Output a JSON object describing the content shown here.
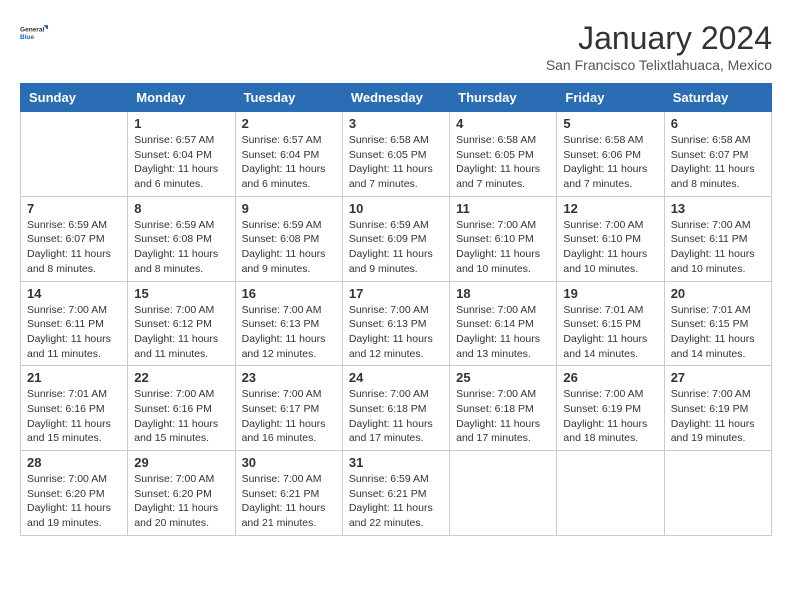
{
  "logo": {
    "line1": "General",
    "line2": "Blue"
  },
  "title": "January 2024",
  "location": "San Francisco Telixtlahuaca, Mexico",
  "headers": [
    "Sunday",
    "Monday",
    "Tuesday",
    "Wednesday",
    "Thursday",
    "Friday",
    "Saturday"
  ],
  "weeks": [
    [
      {
        "date": "",
        "info": ""
      },
      {
        "date": "1",
        "info": "Sunrise: 6:57 AM\nSunset: 6:04 PM\nDaylight: 11 hours\nand 6 minutes."
      },
      {
        "date": "2",
        "info": "Sunrise: 6:57 AM\nSunset: 6:04 PM\nDaylight: 11 hours\nand 6 minutes."
      },
      {
        "date": "3",
        "info": "Sunrise: 6:58 AM\nSunset: 6:05 PM\nDaylight: 11 hours\nand 7 minutes."
      },
      {
        "date": "4",
        "info": "Sunrise: 6:58 AM\nSunset: 6:05 PM\nDaylight: 11 hours\nand 7 minutes."
      },
      {
        "date": "5",
        "info": "Sunrise: 6:58 AM\nSunset: 6:06 PM\nDaylight: 11 hours\nand 7 minutes."
      },
      {
        "date": "6",
        "info": "Sunrise: 6:58 AM\nSunset: 6:07 PM\nDaylight: 11 hours\nand 8 minutes."
      }
    ],
    [
      {
        "date": "7",
        "info": "Sunrise: 6:59 AM\nSunset: 6:07 PM\nDaylight: 11 hours\nand 8 minutes."
      },
      {
        "date": "8",
        "info": "Sunrise: 6:59 AM\nSunset: 6:08 PM\nDaylight: 11 hours\nand 8 minutes."
      },
      {
        "date": "9",
        "info": "Sunrise: 6:59 AM\nSunset: 6:08 PM\nDaylight: 11 hours\nand 9 minutes."
      },
      {
        "date": "10",
        "info": "Sunrise: 6:59 AM\nSunset: 6:09 PM\nDaylight: 11 hours\nand 9 minutes."
      },
      {
        "date": "11",
        "info": "Sunrise: 7:00 AM\nSunset: 6:10 PM\nDaylight: 11 hours\nand 10 minutes."
      },
      {
        "date": "12",
        "info": "Sunrise: 7:00 AM\nSunset: 6:10 PM\nDaylight: 11 hours\nand 10 minutes."
      },
      {
        "date": "13",
        "info": "Sunrise: 7:00 AM\nSunset: 6:11 PM\nDaylight: 11 hours\nand 10 minutes."
      }
    ],
    [
      {
        "date": "14",
        "info": "Sunrise: 7:00 AM\nSunset: 6:11 PM\nDaylight: 11 hours\nand 11 minutes."
      },
      {
        "date": "15",
        "info": "Sunrise: 7:00 AM\nSunset: 6:12 PM\nDaylight: 11 hours\nand 11 minutes."
      },
      {
        "date": "16",
        "info": "Sunrise: 7:00 AM\nSunset: 6:13 PM\nDaylight: 11 hours\nand 12 minutes."
      },
      {
        "date": "17",
        "info": "Sunrise: 7:00 AM\nSunset: 6:13 PM\nDaylight: 11 hours\nand 12 minutes."
      },
      {
        "date": "18",
        "info": "Sunrise: 7:00 AM\nSunset: 6:14 PM\nDaylight: 11 hours\nand 13 minutes."
      },
      {
        "date": "19",
        "info": "Sunrise: 7:01 AM\nSunset: 6:15 PM\nDaylight: 11 hours\nand 14 minutes."
      },
      {
        "date": "20",
        "info": "Sunrise: 7:01 AM\nSunset: 6:15 PM\nDaylight: 11 hours\nand 14 minutes."
      }
    ],
    [
      {
        "date": "21",
        "info": "Sunrise: 7:01 AM\nSunset: 6:16 PM\nDaylight: 11 hours\nand 15 minutes."
      },
      {
        "date": "22",
        "info": "Sunrise: 7:00 AM\nSunset: 6:16 PM\nDaylight: 11 hours\nand 15 minutes."
      },
      {
        "date": "23",
        "info": "Sunrise: 7:00 AM\nSunset: 6:17 PM\nDaylight: 11 hours\nand 16 minutes."
      },
      {
        "date": "24",
        "info": "Sunrise: 7:00 AM\nSunset: 6:18 PM\nDaylight: 11 hours\nand 17 minutes."
      },
      {
        "date": "25",
        "info": "Sunrise: 7:00 AM\nSunset: 6:18 PM\nDaylight: 11 hours\nand 17 minutes."
      },
      {
        "date": "26",
        "info": "Sunrise: 7:00 AM\nSunset: 6:19 PM\nDaylight: 11 hours\nand 18 minutes."
      },
      {
        "date": "27",
        "info": "Sunrise: 7:00 AM\nSunset: 6:19 PM\nDaylight: 11 hours\nand 19 minutes."
      }
    ],
    [
      {
        "date": "28",
        "info": "Sunrise: 7:00 AM\nSunset: 6:20 PM\nDaylight: 11 hours\nand 19 minutes."
      },
      {
        "date": "29",
        "info": "Sunrise: 7:00 AM\nSunset: 6:20 PM\nDaylight: 11 hours\nand 20 minutes."
      },
      {
        "date": "30",
        "info": "Sunrise: 7:00 AM\nSunset: 6:21 PM\nDaylight: 11 hours\nand 21 minutes."
      },
      {
        "date": "31",
        "info": "Sunrise: 6:59 AM\nSunset: 6:21 PM\nDaylight: 11 hours\nand 22 minutes."
      },
      {
        "date": "",
        "info": ""
      },
      {
        "date": "",
        "info": ""
      },
      {
        "date": "",
        "info": ""
      }
    ]
  ]
}
